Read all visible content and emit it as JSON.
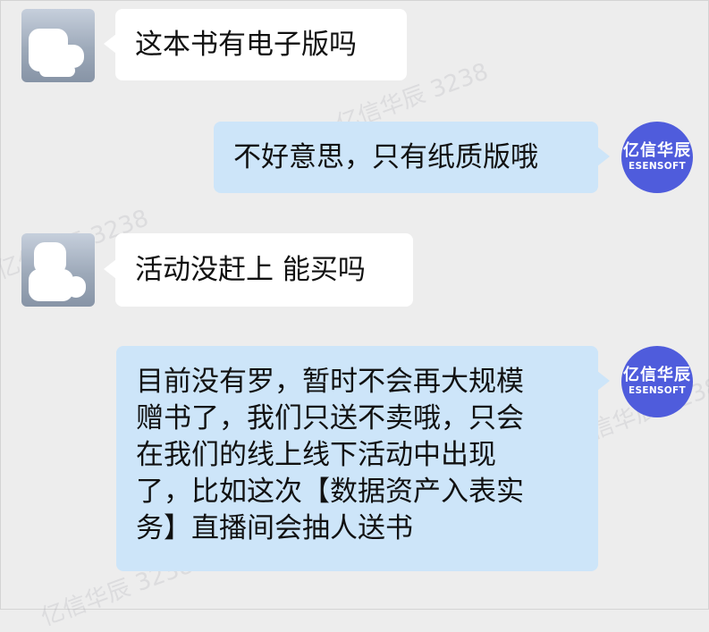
{
  "brand": {
    "name_cn": "亿信华辰",
    "name_en": "ESENSOFT",
    "color": "#4f5cdc"
  },
  "watermark": "亿信华辰 3238",
  "messages": [
    {
      "side": "left",
      "text": "这本书有电子版吗"
    },
    {
      "side": "right",
      "text": "不好意思，只有纸质版哦"
    },
    {
      "side": "left",
      "text": "活动没赶上 能买吗"
    },
    {
      "side": "right",
      "lines": [
        "目前没有罗，暂时不会再大规模",
        "赠书了，我们只送不卖哦，只会",
        "在我们的线上线下活动中出现",
        "了，比如这次【数据资产入表实",
        "务】直播间会抽人送书"
      ]
    }
  ]
}
